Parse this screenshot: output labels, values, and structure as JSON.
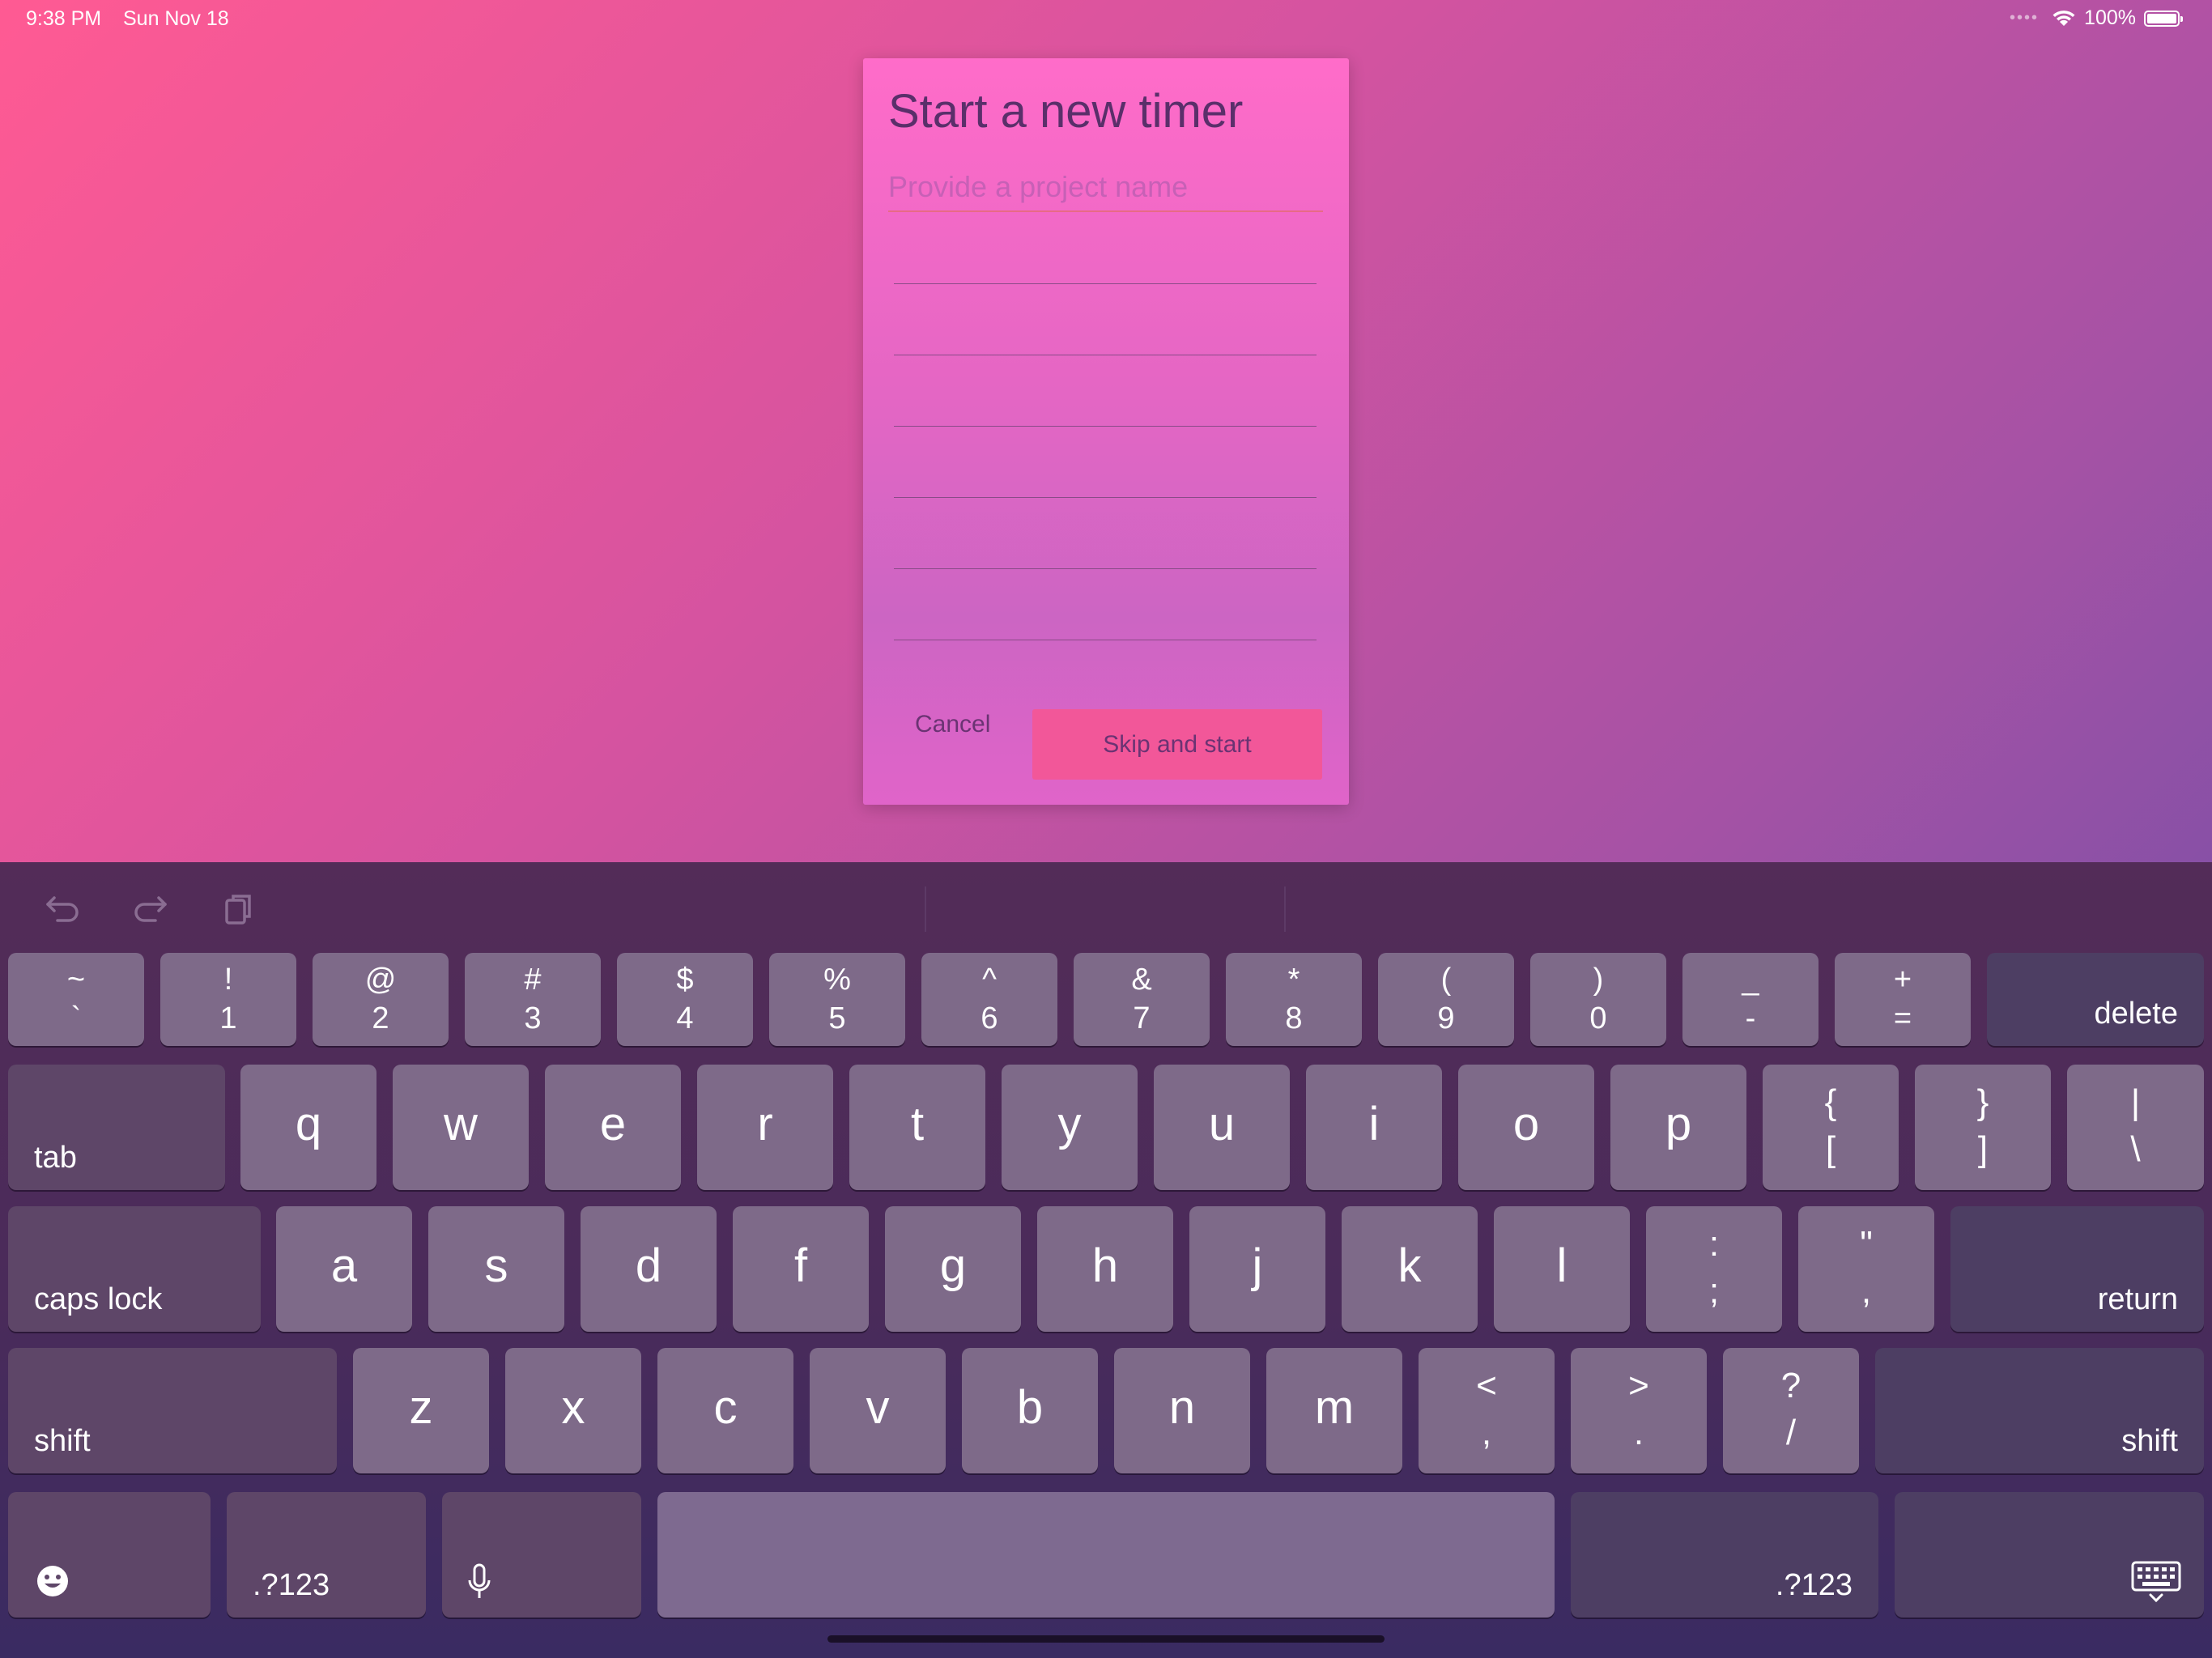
{
  "status_bar": {
    "time": "9:38 PM",
    "date": "Sun Nov 18",
    "battery": "100%"
  },
  "dialog": {
    "title": "Start a new timer",
    "input_placeholder": "Provide a project name",
    "cancel_label": "Cancel",
    "skip_label": "Skip and start"
  },
  "keyboard": {
    "number_row": [
      {
        "top": "~",
        "bottom": "`"
      },
      {
        "top": "!",
        "bottom": "1"
      },
      {
        "top": "@",
        "bottom": "2"
      },
      {
        "top": "#",
        "bottom": "3"
      },
      {
        "top": "$",
        "bottom": "4"
      },
      {
        "top": "%",
        "bottom": "5"
      },
      {
        "top": "^",
        "bottom": "6"
      },
      {
        "top": "&",
        "bottom": "7"
      },
      {
        "top": "*",
        "bottom": "8"
      },
      {
        "top": "(",
        "bottom": "9"
      },
      {
        "top": ")",
        "bottom": "0"
      },
      {
        "top": "_",
        "bottom": "-"
      },
      {
        "top": "+",
        "bottom": "="
      }
    ],
    "delete_label": "delete",
    "tab_label": "tab",
    "row_q": [
      "q",
      "w",
      "e",
      "r",
      "t",
      "y",
      "u",
      "i",
      "o",
      "p"
    ],
    "row_q_symbols": [
      {
        "top": "{",
        "bottom": "["
      },
      {
        "top": "}",
        "bottom": "]"
      },
      {
        "top": "|",
        "bottom": "\\"
      }
    ],
    "caps_label": "caps lock",
    "row_a": [
      "a",
      "s",
      "d",
      "f",
      "g",
      "h",
      "j",
      "k",
      "l"
    ],
    "row_a_symbols": [
      {
        "top": ":",
        "bottom": ";"
      },
      {
        "top": "\"",
        "bottom": ","
      }
    ],
    "return_label": "return",
    "shift_label": "shift",
    "row_z": [
      "z",
      "x",
      "c",
      "v",
      "b",
      "n",
      "m"
    ],
    "row_z_symbols": [
      {
        "top": "<",
        "bottom": ","
      },
      {
        "top": ">",
        "bottom": "."
      },
      {
        "top": "?",
        "bottom": "/"
      }
    ],
    "numbers_label": ".?123"
  }
}
